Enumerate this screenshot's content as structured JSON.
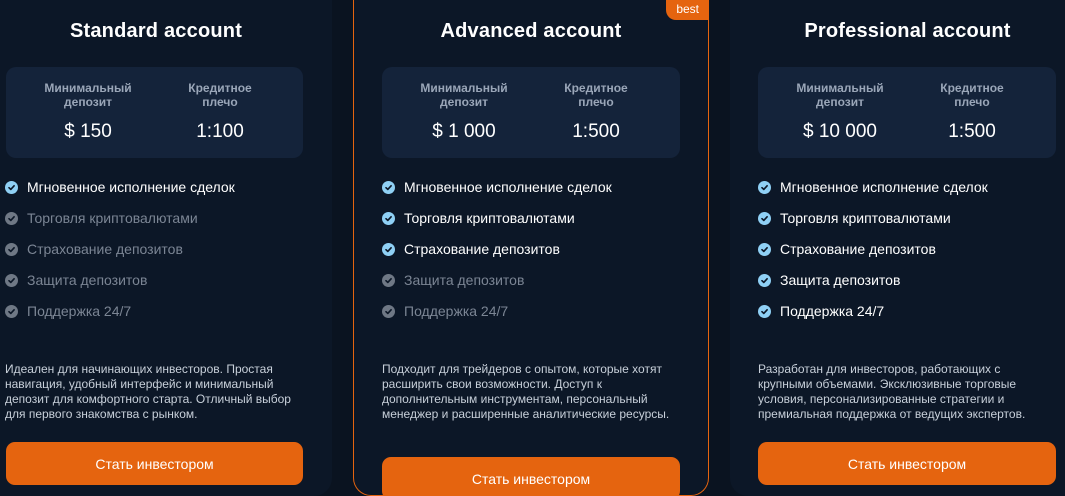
{
  "colors": {
    "accent": "#e5640f",
    "check_active": "#8fd0f5",
    "check_inactive": "#6f7885",
    "card_bg": "#0c1727",
    "stats_bg": "#14233a"
  },
  "plans": {
    "standard": {
      "title": "Standard account",
      "deposit_label": "Минимальный\nдепозит",
      "deposit_value": "$ 150",
      "leverage_label": "Кредитное\nплечо",
      "leverage_value": "1:100",
      "features": [
        {
          "label": "Мгновенное исполнение сделок",
          "included": true
        },
        {
          "label": "Торговля криптовалютами",
          "included": false
        },
        {
          "label": "Страхование депозитов",
          "included": false
        },
        {
          "label": "Защита депозитов",
          "included": false
        },
        {
          "label": "Поддержка 24/7",
          "included": false
        }
      ],
      "description": "Идеален для начинающих инвесторов. Простая навигация, удобный интерфейс и минимальный депозит для комфортного старта. Отличный выбор для первого знакомства с рынком.",
      "button_label": "Стать инвестором"
    },
    "advanced": {
      "badge": "best",
      "title": "Advanced account",
      "deposit_label": "Минимальный\nдепозит",
      "deposit_value": "$ 1 000",
      "leverage_label": "Кредитное\nплечо",
      "leverage_value": "1:500",
      "features": [
        {
          "label": "Мгновенное исполнение сделок",
          "included": true
        },
        {
          "label": "Торговля криптовалютами",
          "included": true
        },
        {
          "label": "Страхование депозитов",
          "included": true
        },
        {
          "label": "Защита депозитов",
          "included": false
        },
        {
          "label": "Поддержка 24/7",
          "included": false
        }
      ],
      "description": "Подходит для трейдеров с опытом, которые хотят расширить свои возможности. Доступ к дополнительным инструментам, персональный менеджер и расширенные аналитические ресурсы.",
      "button_label": "Стать инвестором"
    },
    "professional": {
      "title": "Professional account",
      "deposit_label": "Минимальный\nдепозит",
      "deposit_value": "$ 10 000",
      "leverage_label": "Кредитное\nплечо",
      "leverage_value": "1:500",
      "features": [
        {
          "label": "Мгновенное исполнение сделок",
          "included": true
        },
        {
          "label": "Торговля криптовалютами",
          "included": true
        },
        {
          "label": "Страхование депозитов",
          "included": true
        },
        {
          "label": "Защита депозитов",
          "included": true
        },
        {
          "label": "Поддержка 24/7",
          "included": true
        }
      ],
      "description": "Разработан для инвесторов, работающих с крупными объемами. Эксклюзивные торговые условия, персонализированные стратегии и премиальная поддержка от ведущих экспертов.",
      "button_label": "Стать инвестором"
    }
  }
}
